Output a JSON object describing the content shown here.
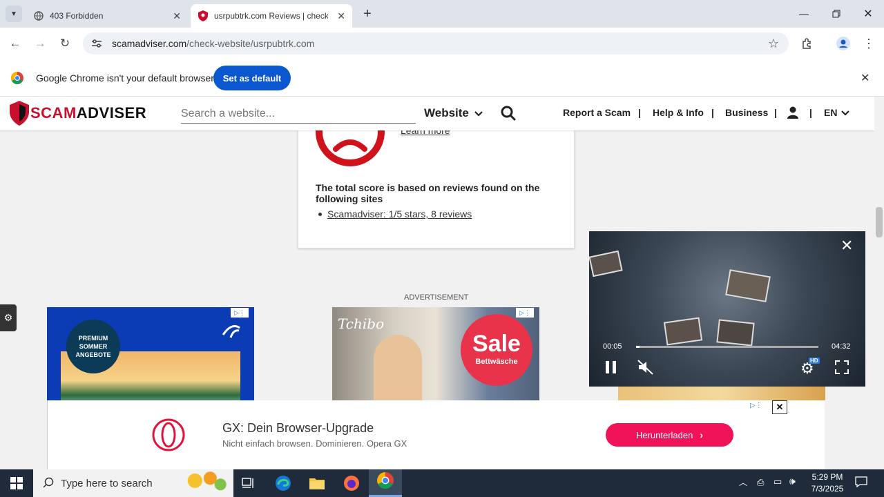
{
  "tabs": [
    {
      "title": "403 Forbidden"
    },
    {
      "title": "usrpubtrk.com Reviews | check"
    }
  ],
  "address": {
    "host": "scamadviser.com",
    "path": "/check-website/usrpubtrk.com"
  },
  "infobar": {
    "message": "Google Chrome isn't your default browser",
    "button": "Set as default"
  },
  "site": {
    "logo_left": "SCAM",
    "logo_right": "ADVISER",
    "search_placeholder": "Search a website...",
    "search_type": "Website",
    "nav": [
      "Report a Scam",
      "Help & Info",
      "Business"
    ],
    "lang": "EN"
  },
  "content": {
    "learn_more": "Learn more",
    "score_text": "The total score is based on reviews found on the following sites",
    "review_link": "Scamadviser: 1/5 stars, 8 reviews"
  },
  "ads": {
    "label": "ADVERTISEMENT",
    "ad1_badge": "PREMIUM SOMMER ANGEBOTE",
    "ad2_brand": "Tchibo",
    "ad2_sale": "Sale",
    "ad2_sub": "Bettwäsche"
  },
  "video": {
    "current": "00:05",
    "duration": "04:32",
    "badge": "HD",
    "progress": 0.02
  },
  "banner": {
    "title": "GX: Dein Browser-Upgrade",
    "subtitle": "Nicht einfach browsen. Dominieren. Opera GX",
    "button": "Herunterladen"
  },
  "taskbar": {
    "search_placeholder": "Type here to search",
    "time": "5:29 PM",
    "date": "7/3/2025"
  },
  "colors": {
    "brand_red": "#c8102e",
    "chrome_blue": "#0b57d0",
    "opera_pink": "#f0135a"
  }
}
